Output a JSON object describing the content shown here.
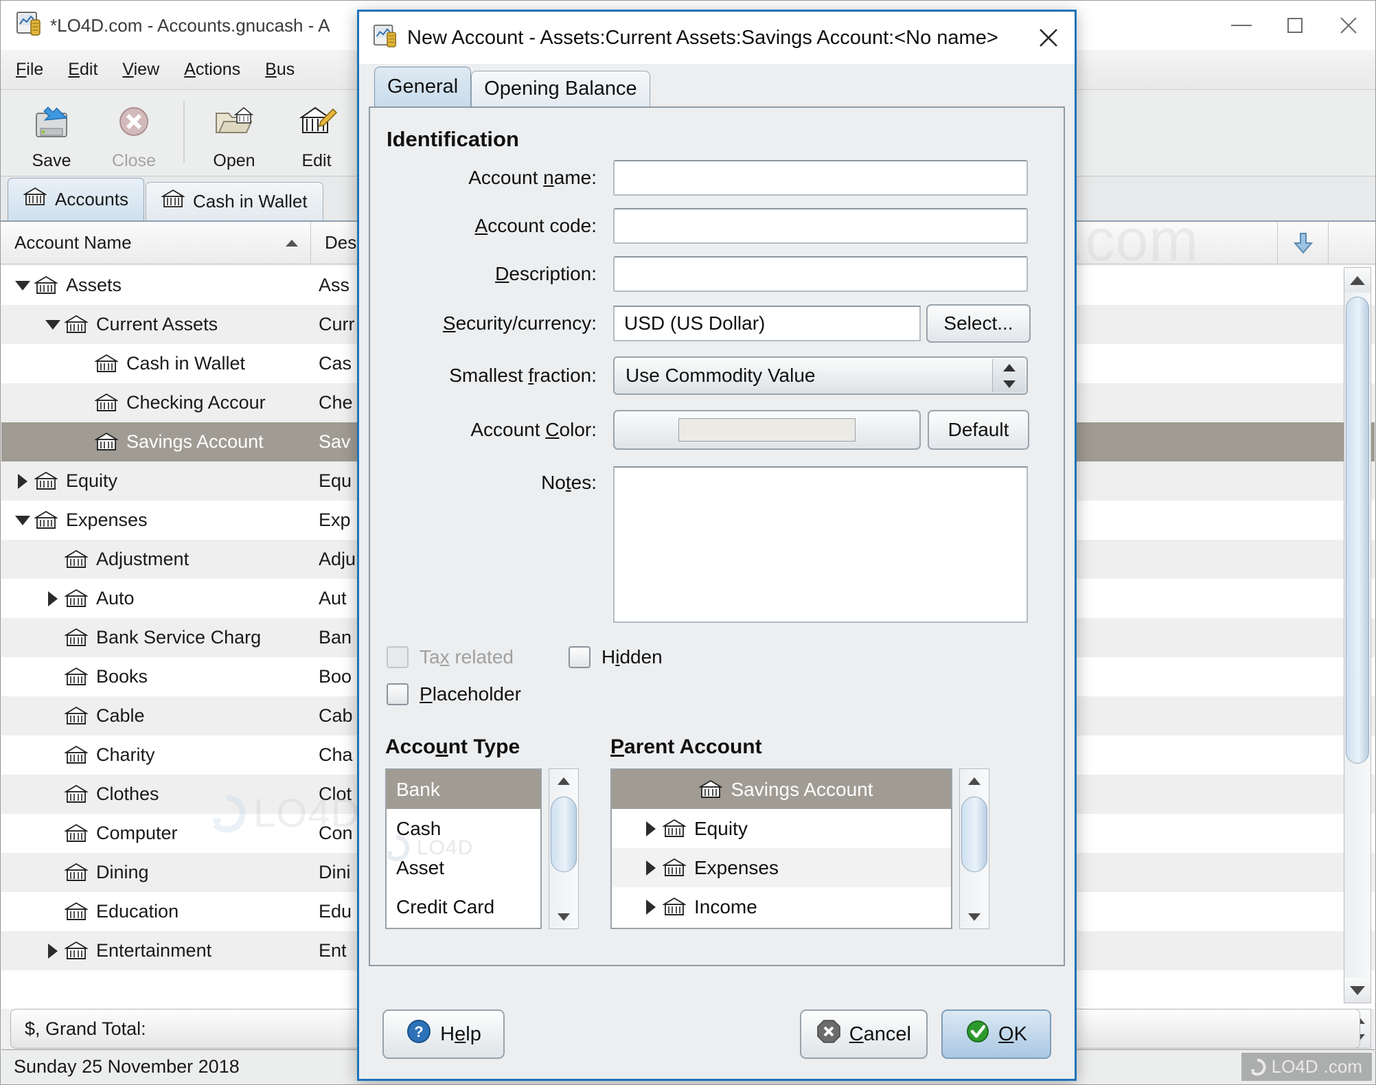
{
  "main_window": {
    "title": "*LO4D.com - Accounts.gnucash - A",
    "window_controls": {
      "minimize": "minimize-icon",
      "maximize": "maximize-icon",
      "close": "close-icon"
    },
    "menubar": [
      {
        "label": "File",
        "mnemonic": "F"
      },
      {
        "label": "Edit",
        "mnemonic": "E"
      },
      {
        "label": "View",
        "mnemonic": "V"
      },
      {
        "label": "Actions",
        "mnemonic": "A"
      },
      {
        "label": "Bus",
        "mnemonic": "B"
      }
    ],
    "toolbar": [
      {
        "label": "Save",
        "icon": "save-icon",
        "enabled": true
      },
      {
        "label": "Close",
        "icon": "close-circle-icon",
        "enabled": false
      },
      {
        "label": "Open",
        "icon": "open-folder-icon",
        "enabled": true
      },
      {
        "label": "Edit",
        "icon": "edit-account-icon",
        "enabled": true
      }
    ],
    "tabs": [
      {
        "label": "Accounts",
        "icon": "bank-icon",
        "active": true
      },
      {
        "label": "Cash in Wallet",
        "icon": "bank-icon",
        "active": false
      }
    ],
    "columns": [
      "Account Name",
      "Des"
    ],
    "sort_indicator": "ascending",
    "tree": [
      {
        "name": "Assets",
        "desc": "Ass",
        "depth": 0,
        "expander": "down",
        "selected": false
      },
      {
        "name": "Current Assets",
        "desc": "Curr",
        "depth": 1,
        "expander": "down",
        "selected": false
      },
      {
        "name": "Cash in Wallet",
        "desc": "Cas",
        "depth": 2,
        "expander": "none",
        "selected": false
      },
      {
        "name": "Checking Accour",
        "desc": "Che",
        "depth": 2,
        "expander": "none",
        "selected": false
      },
      {
        "name": "Savings Account",
        "desc": "Sav",
        "depth": 2,
        "expander": "none",
        "selected": true
      },
      {
        "name": "Equity",
        "desc": "Equ",
        "depth": 0,
        "expander": "right",
        "selected": false
      },
      {
        "name": "Expenses",
        "desc": "Exp",
        "depth": 0,
        "expander": "down",
        "selected": false
      },
      {
        "name": "Adjustment",
        "desc": "Adju",
        "depth": 1,
        "expander": "none",
        "selected": false
      },
      {
        "name": "Auto",
        "desc": "Aut",
        "depth": 1,
        "expander": "right",
        "selected": false
      },
      {
        "name": "Bank Service Charg",
        "desc": "Ban",
        "depth": 1,
        "expander": "none",
        "selected": false
      },
      {
        "name": "Books",
        "desc": "Boo",
        "depth": 1,
        "expander": "none",
        "selected": false
      },
      {
        "name": "Cable",
        "desc": "Cab",
        "depth": 1,
        "expander": "none",
        "selected": false
      },
      {
        "name": "Charity",
        "desc": "Cha",
        "depth": 1,
        "expander": "none",
        "selected": false
      },
      {
        "name": "Clothes",
        "desc": "Clot",
        "depth": 1,
        "expander": "none",
        "selected": false
      },
      {
        "name": "Computer",
        "desc": "Con",
        "depth": 1,
        "expander": "none",
        "selected": false
      },
      {
        "name": "Dining",
        "desc": "Dini",
        "depth": 1,
        "expander": "none",
        "selected": false
      },
      {
        "name": "Education",
        "desc": "Edu",
        "depth": 1,
        "expander": "none",
        "selected": false
      },
      {
        "name": "Entertainment",
        "desc": "Ent",
        "depth": 1,
        "expander": "right",
        "selected": false
      }
    ],
    "grand_total": "$, Grand Total:",
    "statusbar": "Sunday 25 November 2018"
  },
  "dialog": {
    "title": "New Account - Assets:Current Assets:Savings Account:<No name>",
    "icon": "gnucash-icon",
    "close_icon": "close-icon",
    "tabs": [
      {
        "label": "General",
        "active": true
      },
      {
        "label": "Opening Balance",
        "active": false
      }
    ],
    "section_title": "Identification",
    "fields": {
      "account_name": {
        "label": "Account name:",
        "mnem_pre": "Account ",
        "mnem": "n",
        "mnem_post": "ame:",
        "value": ""
      },
      "account_code": {
        "label": "Account code:",
        "mnem_pre": "",
        "mnem": "A",
        "mnem_post": "ccount code:",
        "value": ""
      },
      "description": {
        "label": "Description:",
        "mnem_pre": "",
        "mnem": "D",
        "mnem_post": "escription:",
        "value": ""
      },
      "security": {
        "label": "Security/currency:",
        "mnem_pre": "",
        "mnem": "S",
        "mnem_post": "ecurity/currency:",
        "value": "USD (US Dollar)",
        "button": "Select..."
      },
      "fraction": {
        "label": "Smallest fraction:",
        "mnem_pre": "Smallest ",
        "mnem": "f",
        "mnem_post": "raction:",
        "value": "Use Commodity Value"
      },
      "color": {
        "label": "Account Color:",
        "mnem_pre": "Account ",
        "mnem": "C",
        "mnem_post": "olor:",
        "swatch": "#eceae4",
        "button": "Default"
      },
      "notes": {
        "label": "Notes:",
        "mnem_pre": "No",
        "mnem": "t",
        "mnem_post": "es:",
        "value": ""
      }
    },
    "checkboxes": [
      {
        "key": "tax_related",
        "pre": "Ta",
        "mnem": "x",
        "post": " related",
        "checked": false,
        "enabled": false
      },
      {
        "key": "hidden",
        "pre": "H",
        "mnem": "i",
        "post": "dden",
        "checked": false,
        "enabled": true
      },
      {
        "key": "placeholder",
        "pre": "",
        "mnem": "P",
        "post": "laceholder",
        "checked": false,
        "enabled": true
      }
    ],
    "account_type": {
      "heading": "Account Type",
      "head_pre": "Acco",
      "head_mnem": "u",
      "head_post": "nt Type",
      "items": [
        {
          "label": "Bank",
          "selected": true
        },
        {
          "label": "Cash",
          "selected": false
        },
        {
          "label": "Asset",
          "selected": false
        },
        {
          "label": "Credit Card",
          "selected": false
        }
      ]
    },
    "parent_account": {
      "heading": "Parent Account",
      "head_pre": "",
      "head_mnem": "P",
      "head_post": "arent Account",
      "items": [
        {
          "label": "Savings Account",
          "expander": "none",
          "selected": true,
          "icon": "bank-icon"
        },
        {
          "label": "Equity",
          "expander": "right",
          "selected": false,
          "icon": "bank-icon"
        },
        {
          "label": "Expenses",
          "expander": "right",
          "selected": false,
          "icon": "bank-icon"
        },
        {
          "label": "Income",
          "expander": "right",
          "selected": false,
          "icon": "bank-icon"
        }
      ]
    },
    "footer": {
      "help": {
        "pre": "H",
        "mnem": "e",
        "post": "lp",
        "icon": "help-icon"
      },
      "cancel": {
        "pre": "",
        "mnem": "C",
        "post": "ancel",
        "icon": "cancel-icon"
      },
      "ok": {
        "pre": "",
        "mnem": "O",
        "post": "K",
        "icon": "ok-check-icon"
      }
    }
  },
  "watermark": {
    "text": "LO4D",
    "suffix": ".com"
  },
  "colors": {
    "dialog_border": "#1f72b8",
    "selection": "#a09c93",
    "chrome_bg": "#eceef0",
    "accent_blue": "#1f72b8"
  }
}
